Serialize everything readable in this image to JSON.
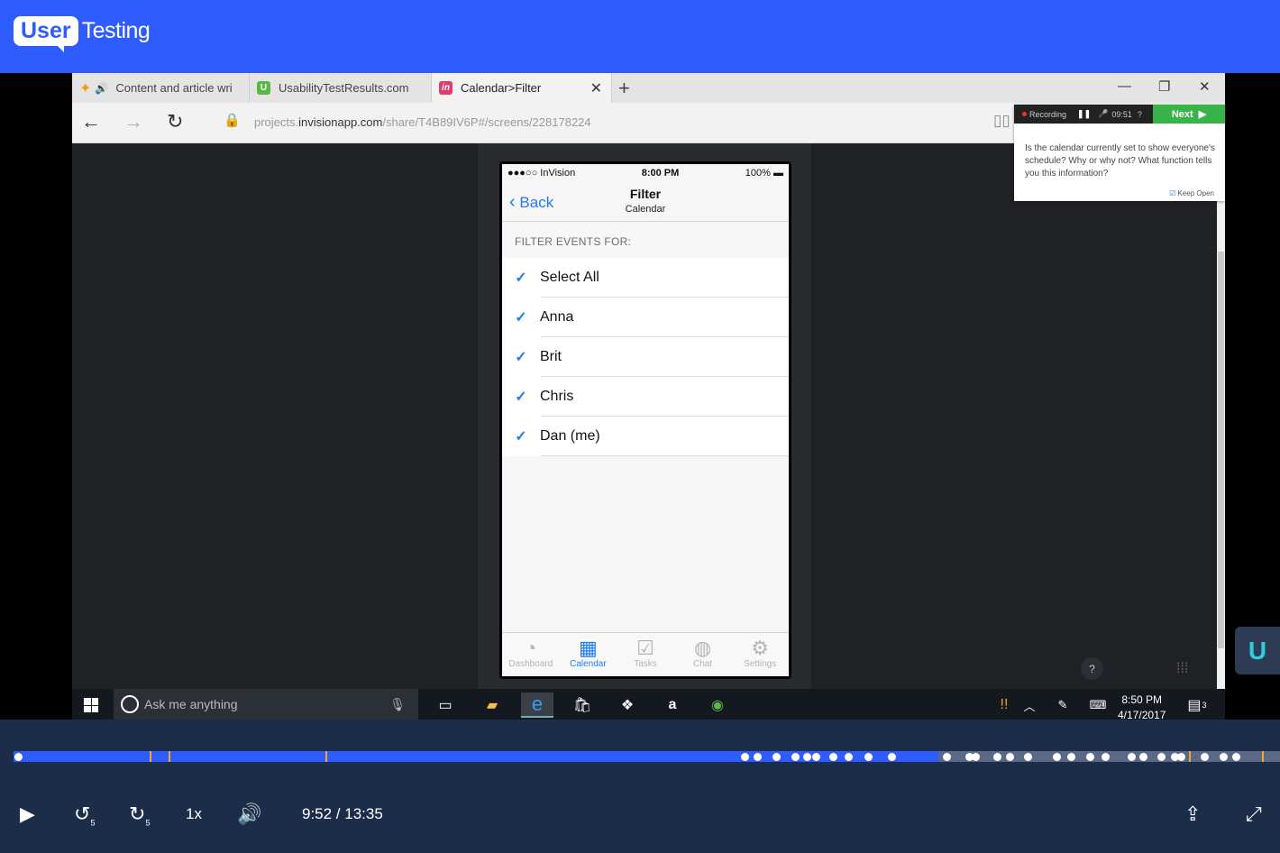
{
  "app": {
    "brand_box": "User",
    "brand_text": "Testing"
  },
  "browser": {
    "tabs": [
      {
        "label": "Content and article wri"
      },
      {
        "label": "UsabilityTestResults.com"
      },
      {
        "label": "Calendar>Filter"
      }
    ],
    "url_prefix": "projects.",
    "url_domain": "invisionapp.com",
    "url_path": "/share/T4B89IV6P#/screens/228178224"
  },
  "phone": {
    "carrier": "●●●○○ InVision",
    "time": "8:00 PM",
    "battery": "100%",
    "back_label": "Back",
    "title": "Filter",
    "subtitle": "Calendar",
    "section_header": "FILTER EVENTS FOR:",
    "items": [
      "Select All",
      "Anna",
      "Brit",
      "Chris",
      "Dan (me)"
    ],
    "tabs": [
      {
        "label": "Dashboard",
        "icon": "dashboard-icon"
      },
      {
        "label": "Calendar",
        "icon": "calendar-icon"
      },
      {
        "label": "Tasks",
        "icon": "tasks-icon"
      },
      {
        "label": "Chat",
        "icon": "chat-icon"
      },
      {
        "label": "Settings",
        "icon": "settings-icon"
      }
    ],
    "active_tab": "Calendar"
  },
  "recorder": {
    "status": "Recording",
    "timer": "09:51",
    "next_label": "Next",
    "question": "Is the calendar currently set to show everyone's schedule? Why or why not? What function tells you this information?",
    "keep_open": "Keep Open"
  },
  "taskbar": {
    "search_placeholder": "Ask me anything",
    "time": "8:50 PM",
    "date": "4/17/2017",
    "notification_count": "3"
  },
  "help": {
    "label": "?"
  },
  "player": {
    "current": "9:52",
    "total": "13:35",
    "time_display": "9:52 / 13:35",
    "speed": "1x",
    "progress_fraction": 0.73
  },
  "colors": {
    "brand": "#2f5cff",
    "accent": "#1f7cf0",
    "controls_bg": "#1c2d4a",
    "next_button": "#37b34a"
  }
}
